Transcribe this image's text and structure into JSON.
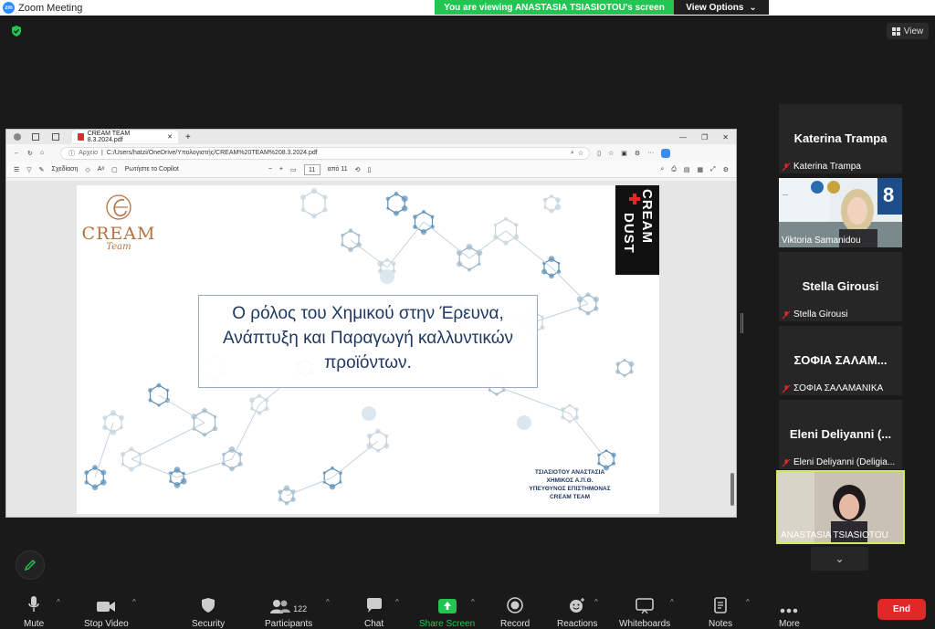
{
  "window": {
    "title": "Zoom Meeting",
    "logo_text": "zm"
  },
  "banner": {
    "viewing_text": "You are viewing ANASTASIA TSIASIOTOU's screen",
    "view_options_label": "View Options"
  },
  "view_button": {
    "label": "View"
  },
  "browser": {
    "tab_title": "CREAM TEAM 8.3.2024.pdf",
    "address_label": "Αρχείο",
    "address_url": "C:/Users/hatzi/OneDrive/Υπολογιστής/CREAM%20TEAM%208.3.2024.pdf",
    "draw_label": "Σχεδίαση",
    "copilot_label": "Ρωτήστε το Copilot",
    "page_current": "11",
    "page_total": "από 11"
  },
  "slide": {
    "logo_word": "CREAM",
    "logo_sub": "Team",
    "dust_line1": "DUST",
    "dust_line2": "CREAM",
    "title_line1": "Ο ρόλος του Χημικού στην Έρευνα,",
    "title_line2": "Ανάπτυξη και Παραγωγή καλλυντικών",
    "title_line3": "προϊόντων.",
    "sig_line1": "ΤΣΙΑΣΙΟΤΟΥ ΑΝΑΣΤΑΣΙΑ",
    "sig_line2": "ΧΗΜΙΚΟΣ Α.Π.Θ.",
    "sig_line3": "ΥΠΕΥΘΥΝΟΣ ΕΠΙΣΤΗΜΟΝΑΣ",
    "sig_line4": "CREAM TEAM"
  },
  "participants": [
    {
      "display": "Katerina Trampa",
      "label": "Katerina Trampa",
      "video": false
    },
    {
      "display": "",
      "label": "Viktoria Samanidou",
      "video": true
    },
    {
      "display": "Stella Girousi",
      "label": "Stella Girousi",
      "video": false
    },
    {
      "display": "ΣΟΦΙΑ ΣΑΛΑΜ...",
      "label": "ΣΟΦΙΑ ΣΑΛΑΜΑΝΙΚΑ",
      "video": false
    },
    {
      "display": "Eleni Deliyanni (...",
      "label": "Eleni Deliyanni (Deligia...",
      "video": false
    },
    {
      "display": "",
      "label": "ANASTASIA TSIASIOTOU",
      "video": true
    }
  ],
  "toolbar": {
    "mute": "Mute",
    "stop_video": "Stop Video",
    "security": "Security",
    "participants": "Participants",
    "participants_count": "122",
    "chat": "Chat",
    "share_screen": "Share Screen",
    "record": "Record",
    "reactions": "Reactions",
    "whiteboards": "Whiteboards",
    "notes": "Notes",
    "more": "More",
    "end": "End"
  },
  "colors": {
    "share_green": "#23c552",
    "end_red": "#e02828",
    "active_speaker": "#cfe86a"
  }
}
